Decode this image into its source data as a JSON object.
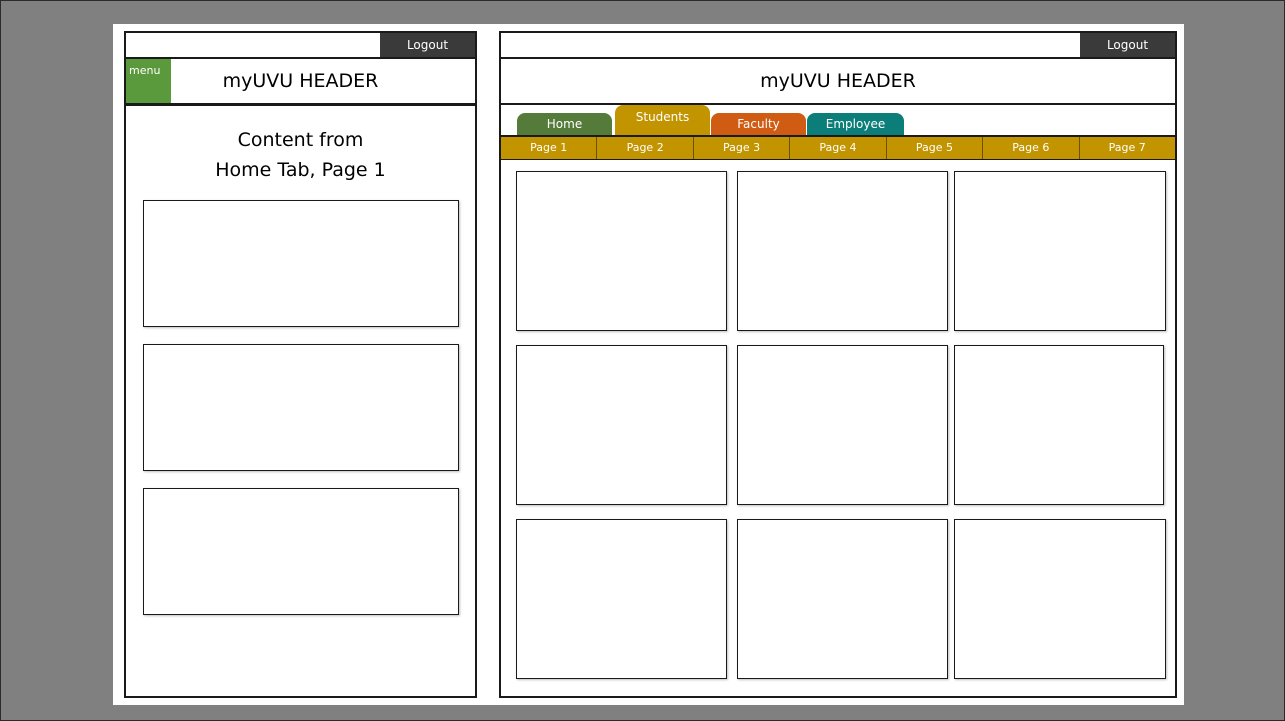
{
  "mobile": {
    "logout_label": "Logout",
    "menu_label": "menu",
    "header_title": "myUVU HEADER",
    "content_title_line1": "Content from",
    "content_title_line2": "Home Tab, Page 1"
  },
  "desktop": {
    "logout_label": "Logout",
    "header_title": "myUVU HEADER",
    "tabs": [
      {
        "label": "Home",
        "color": "#547b3a"
      },
      {
        "label": "Students",
        "color": "#c29400"
      },
      {
        "label": "Faculty",
        "color": "#cf5c12"
      },
      {
        "label": "Employee",
        "color": "#0c7e7a"
      }
    ],
    "active_tab": "Students",
    "pages": [
      "Page 1",
      "Page 2",
      "Page 3",
      "Page 4",
      "Page 5",
      "Page 6",
      "Page 7"
    ]
  },
  "colors": {
    "background": "#808080",
    "menu_green": "#5b9a3c",
    "logout_bg": "#3a3a3a",
    "page_bar": "#c29400"
  }
}
